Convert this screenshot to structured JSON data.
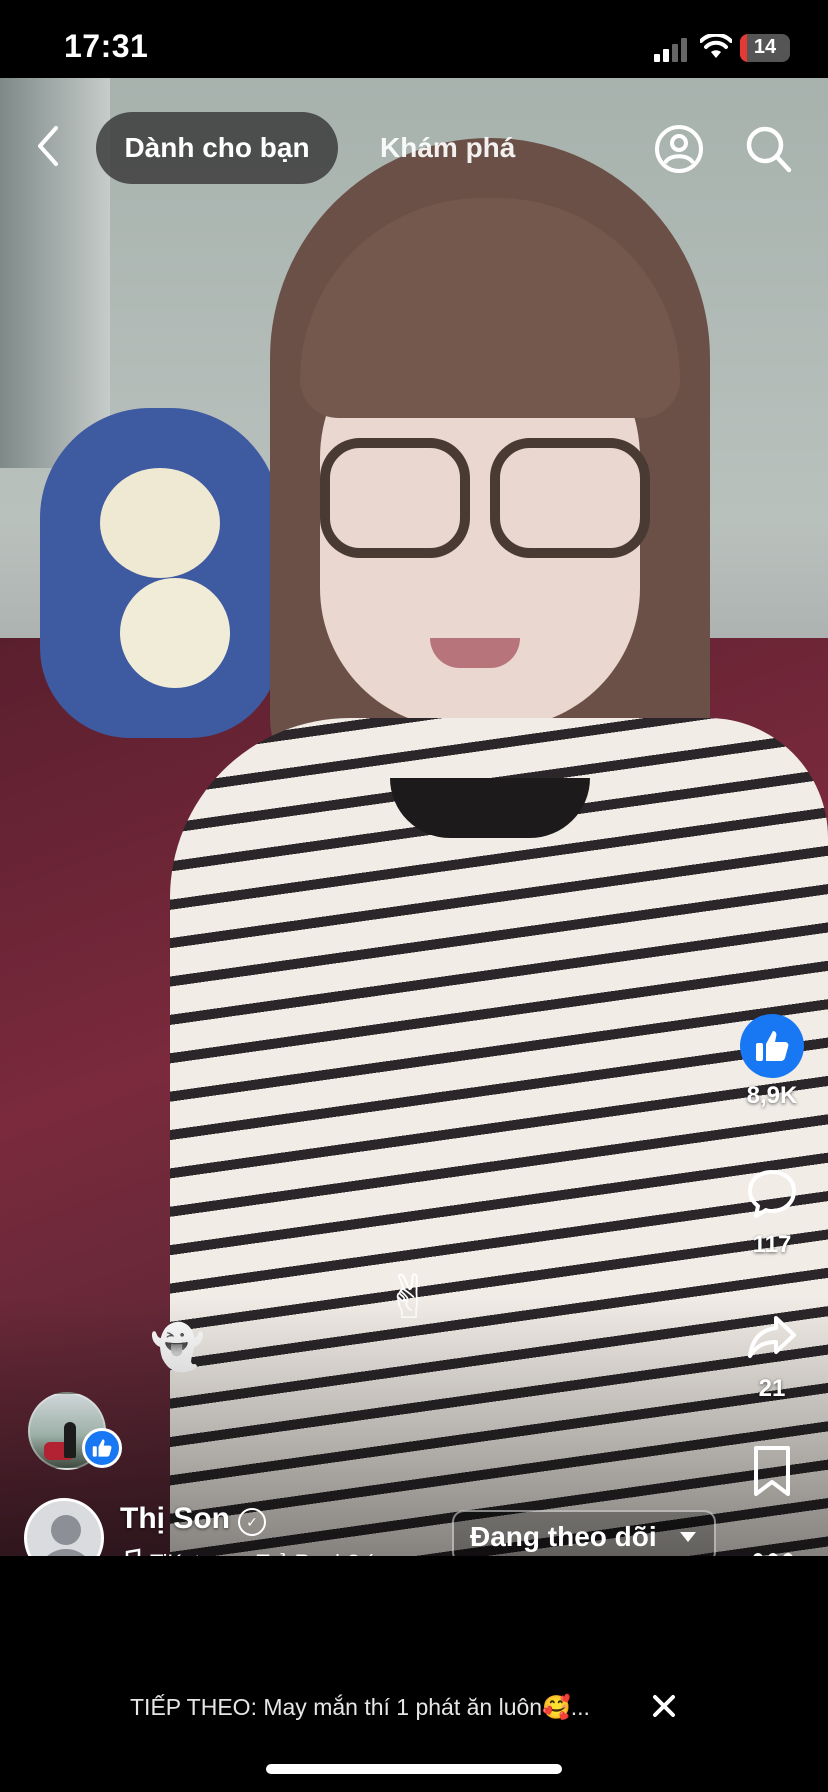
{
  "status_bar": {
    "time": "17:31",
    "battery": "14"
  },
  "nav": {
    "tabs": [
      {
        "label": "Dành cho bạn"
      },
      {
        "label": "Khám phá"
      }
    ]
  },
  "actions": {
    "likes": "8,9K",
    "comments": "117",
    "shares": "21"
  },
  "creator": {
    "name": "Thị Son",
    "music": "TiKatana · Trẻ Ranh? (..."
  },
  "follow_button": {
    "label": "Đang theo dõi"
  },
  "next_up": {
    "text": "TIẾP THEO: May mắn thí 1 phát ăn luôn🥰..."
  },
  "colors": {
    "facebook_blue": "#1877f2",
    "battery_low": "#e53935"
  },
  "icons": [
    "back-icon",
    "profile-icon",
    "search-icon",
    "like-icon",
    "comment-icon",
    "share-icon",
    "bookmark-icon",
    "more-icon",
    "music-note-icon",
    "close-icon"
  ]
}
